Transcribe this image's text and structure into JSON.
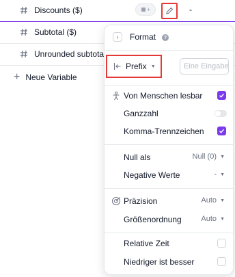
{
  "variables": [
    {
      "name": "Discounts ($)",
      "chip_label": "+",
      "value": "-"
    },
    {
      "name": "Subtotal ($)"
    },
    {
      "name": "Unrounded subtotal ("
    }
  ],
  "add_variable": {
    "icon": "plus-icon",
    "label": "Neue Variable"
  },
  "popup": {
    "title": "Format",
    "prefix": {
      "label": "Prefix",
      "placeholder": "Eine Eingabe vo"
    },
    "options": {
      "human_readable": {
        "label": "Von Menschen lesbar",
        "checked": true
      },
      "integer": {
        "label": "Ganzzahl",
        "on": false
      },
      "thousands_sep": {
        "label": "Komma-Trennzeichen",
        "checked": true
      },
      "null_as": {
        "label": "Null als",
        "value": "Null (0)"
      },
      "negative": {
        "label": "Negative Werte",
        "value": "-"
      },
      "precision": {
        "label": "Präzision",
        "value": "Auto"
      },
      "magnitude": {
        "label": "Größenordnung",
        "value": "Auto"
      },
      "relative_time": {
        "label": "Relative Zeit",
        "checked": false
      },
      "lower_better": {
        "label": "Niedriger ist besser",
        "checked": false
      }
    }
  },
  "colors": {
    "accent": "#7c3aed",
    "highlight": "#e53935"
  }
}
